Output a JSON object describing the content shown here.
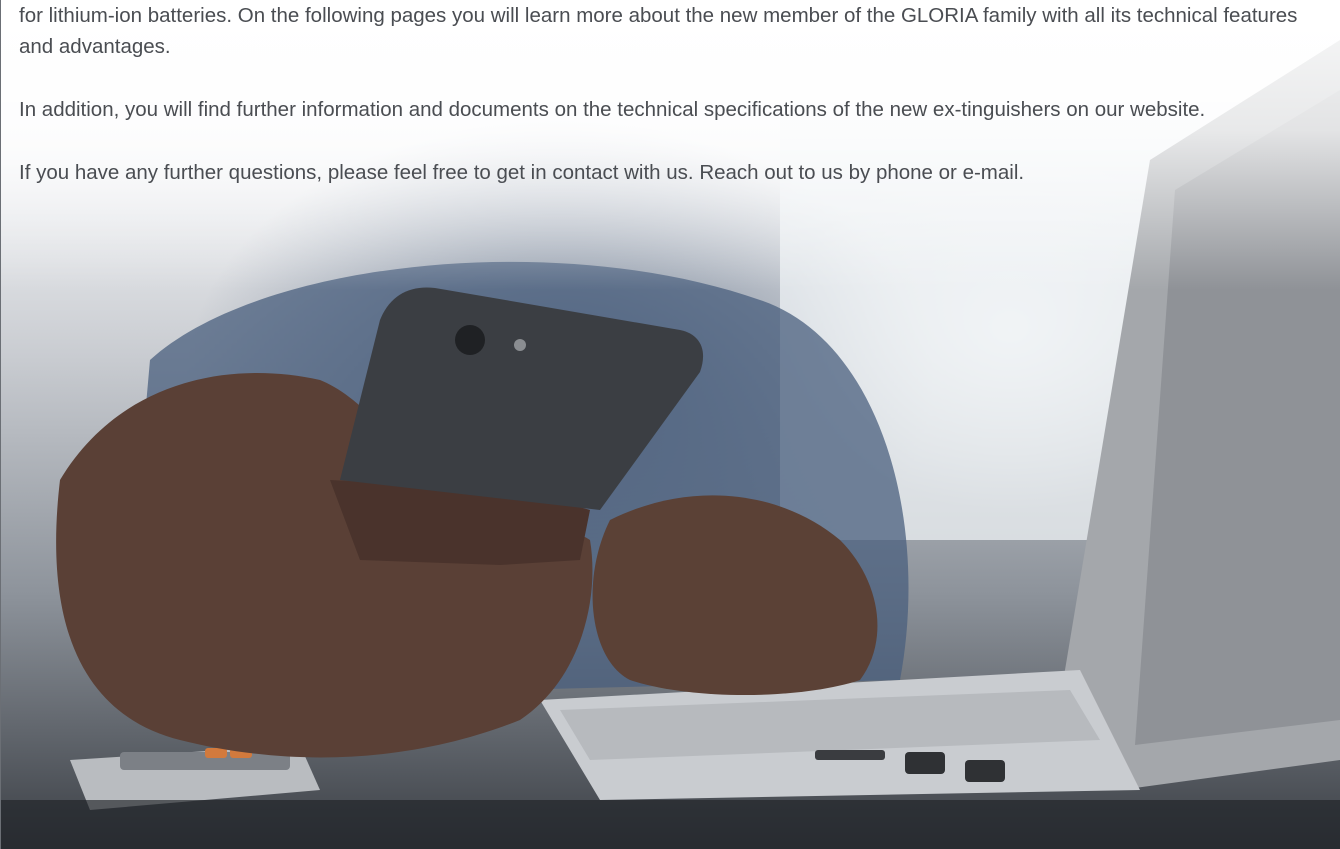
{
  "body": {
    "paragraphs": [
      "for lithium-ion batteries. On the following pages you will learn more about the new member of the GLORIA family with all its technical features and advantages.",
      "In addition, you will find further information and documents on the technical specifications of the new ex-tinguishers on our website.",
      "If you have any further questions, please feel free to get in contact with us. Reach out to us by phone or e-mail."
    ]
  },
  "colors": {
    "text": "#4a4d52",
    "background_top": "#ffffff",
    "background_bottom": "#3b3f45"
  },
  "photo": {
    "icon_names": [
      "hand-holding-phone",
      "smartphone",
      "laptop",
      "calculator",
      "hand-on-keyboard"
    ]
  }
}
